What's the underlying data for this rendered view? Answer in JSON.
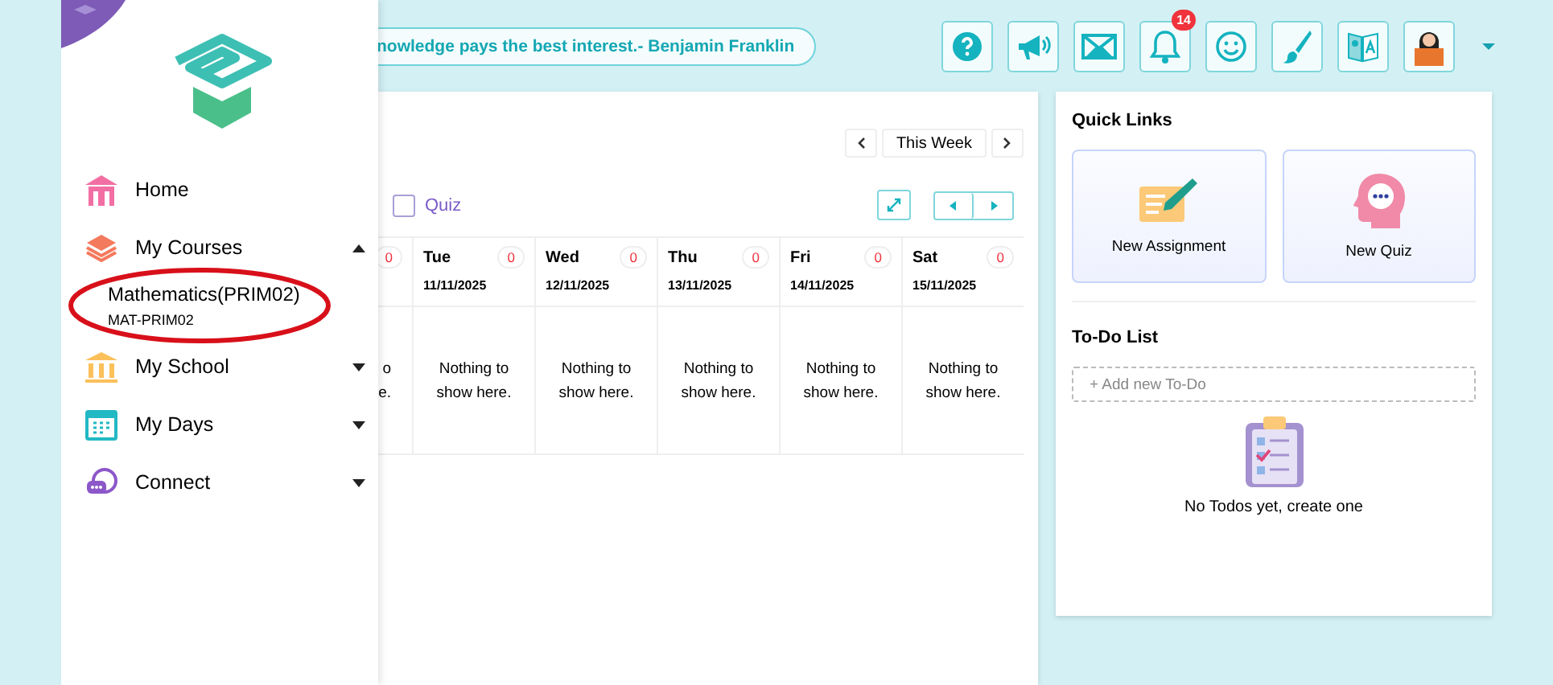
{
  "header": {
    "quote": "nowledge pays the best interest.- Benjamin Franklin",
    "notification_badge": "14"
  },
  "sidebar": {
    "items": [
      {
        "label": "Home",
        "kind": "link"
      },
      {
        "label": "My Courses",
        "kind": "group",
        "expanded": true,
        "children": [
          {
            "title": "Mathematics(PRIM02)",
            "code": "MAT-PRIM02",
            "highlighted": true
          }
        ]
      },
      {
        "label": "My School",
        "kind": "group",
        "expanded": false
      },
      {
        "label": "My Days",
        "kind": "group",
        "expanded": false
      },
      {
        "label": "Connect",
        "kind": "group",
        "expanded": false
      }
    ]
  },
  "schedule": {
    "week_label": "This Week",
    "filter": {
      "label": "Quiz",
      "checked": false
    },
    "days": [
      {
        "count": "0",
        "message": "o\ne."
      },
      {
        "day": "Tue",
        "date": "11/11/2025",
        "count": "0",
        "message": "Nothing to show here."
      },
      {
        "day": "Wed",
        "date": "12/11/2025",
        "count": "0",
        "message": "Nothing to show here."
      },
      {
        "day": "Thu",
        "date": "13/11/2025",
        "count": "0",
        "message": "Nothing to show here."
      },
      {
        "day": "Fri",
        "date": "14/11/2025",
        "count": "0",
        "message": "Nothing to show here."
      },
      {
        "day": "Sat",
        "date": "15/11/2025",
        "count": "0",
        "message": "Nothing to show here."
      }
    ]
  },
  "quick_links": {
    "title": "Quick Links",
    "links": [
      {
        "label": "New Assignment"
      },
      {
        "label": "New Quiz"
      }
    ]
  },
  "todo": {
    "title": "To-Do List",
    "placeholder": "+ Add new To-Do",
    "empty": "No Todos yet, create one"
  }
}
